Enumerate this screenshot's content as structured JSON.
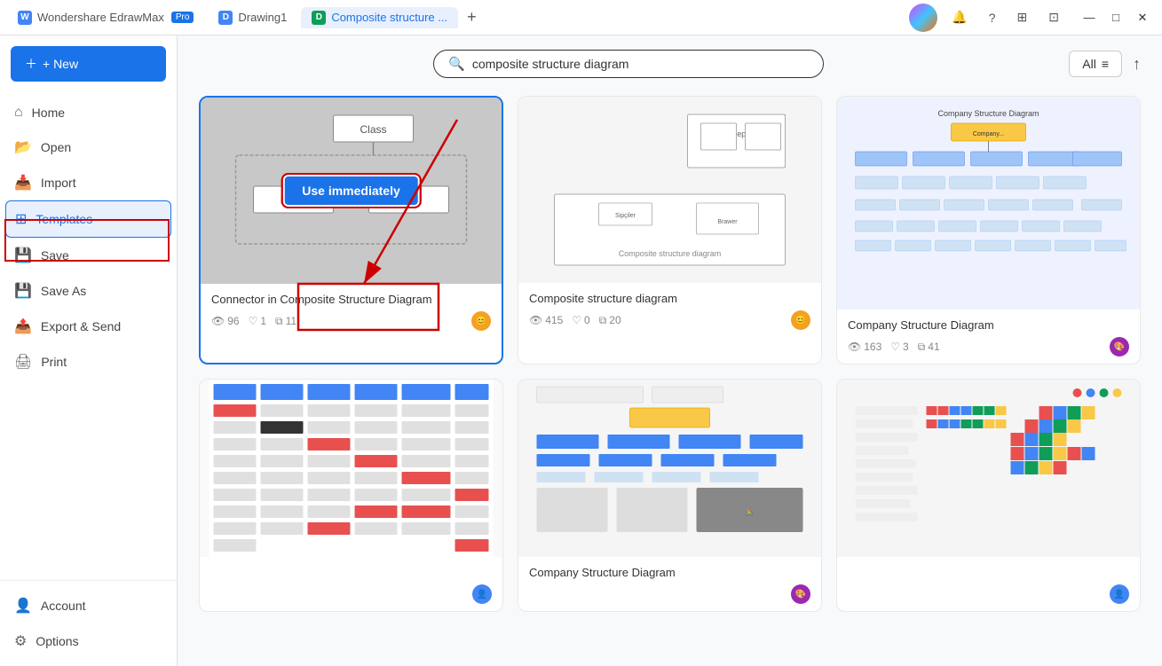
{
  "app": {
    "name": "Wondershare EdrawMax",
    "badge": "Pro",
    "tabs": [
      {
        "label": "Drawing1",
        "icon": "D",
        "active": false
      },
      {
        "label": "Composite structure ...",
        "icon": "D",
        "active": true
      }
    ],
    "add_tab": "+"
  },
  "titlebar": {
    "notification_icon": "🔔",
    "help_icon": "?",
    "grid_icon": "⊞",
    "layout_icon": "⊡",
    "minimize": "—",
    "maximize": "□",
    "close": "✕"
  },
  "sidebar": {
    "new_label": "+ New",
    "items": [
      {
        "id": "home",
        "label": "Home",
        "icon": "⌂"
      },
      {
        "id": "open",
        "label": "Open",
        "icon": "📂"
      },
      {
        "id": "import",
        "label": "Import",
        "icon": "📥"
      },
      {
        "id": "templates",
        "label": "Templates",
        "icon": "⊞",
        "active": true
      },
      {
        "id": "save",
        "label": "Save",
        "icon": "💾"
      },
      {
        "id": "save-as",
        "label": "Save As",
        "icon": "💾"
      },
      {
        "id": "export-send",
        "label": "Export & Send",
        "icon": "📤"
      },
      {
        "id": "print",
        "label": "Print",
        "icon": "🖨"
      }
    ],
    "bottom_items": [
      {
        "id": "account",
        "label": "Account",
        "icon": "👤"
      },
      {
        "id": "options",
        "label": "Options",
        "icon": "⚙"
      }
    ]
  },
  "search": {
    "placeholder": "composite structure diagram",
    "value": "composite structure diagram",
    "filter_label": "All",
    "filter_icon": "≡"
  },
  "templates": [
    {
      "id": "connector-composite",
      "title": "Connector in Composite Structure Diagram",
      "views": "96",
      "likes": "1",
      "copies": "11",
      "avatar_color": "#f4a020",
      "highlighted": true,
      "show_use_immediately": true,
      "use_immediately_label": "Use immediately"
    },
    {
      "id": "composite-structure",
      "title": "Composite structure diagram",
      "views": "415",
      "likes": "0",
      "copies": "20",
      "avatar_color": "#f4a020",
      "highlighted": false,
      "show_use_immediately": false
    },
    {
      "id": "company-structure",
      "title": "Company Structure Diagram",
      "views": "163",
      "likes": "3",
      "copies": "41",
      "avatar_color": "#9c27b0",
      "highlighted": false,
      "show_use_immediately": false
    },
    {
      "id": "kanban-board",
      "title": "",
      "views": "",
      "likes": "",
      "copies": "",
      "avatar_color": "#4285f4",
      "highlighted": false,
      "show_use_immediately": false
    },
    {
      "id": "company-structure-2",
      "title": "Company Structure Diagram",
      "views": "",
      "likes": "",
      "copies": "",
      "avatar_color": "#9c27b0",
      "highlighted": false,
      "show_use_immediately": false
    },
    {
      "id": "mosaic-chart",
      "title": "",
      "views": "",
      "likes": "",
      "copies": "",
      "avatar_color": "#1a73e8",
      "highlighted": false,
      "show_use_immediately": false
    }
  ],
  "stats_icons": {
    "view": "👁",
    "like": "♡",
    "copy": "⧉"
  }
}
